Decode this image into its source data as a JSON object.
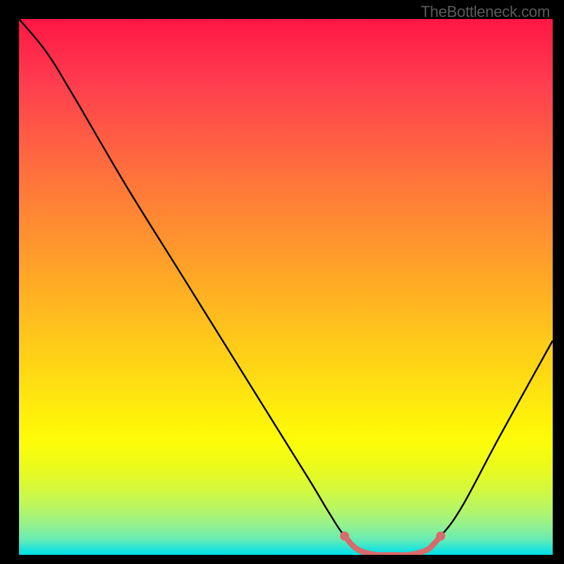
{
  "watermark": "TheBottleneck.com",
  "chart_data": {
    "type": "line",
    "title": "",
    "xlabel": "",
    "ylabel": "",
    "xlim": [
      0,
      100
    ],
    "ylim": [
      0,
      100
    ],
    "series": [
      {
        "name": "bottleneck-curve",
        "points": [
          {
            "x": 0,
            "y": 100
          },
          {
            "x": 5,
            "y": 94
          },
          {
            "x": 10,
            "y": 86
          },
          {
            "x": 20,
            "y": 69
          },
          {
            "x": 30,
            "y": 53
          },
          {
            "x": 40,
            "y": 37
          },
          {
            "x": 50,
            "y": 21
          },
          {
            "x": 55,
            "y": 13
          },
          {
            "x": 58,
            "y": 8
          },
          {
            "x": 61,
            "y": 3.5
          },
          {
            "x": 64,
            "y": 1
          },
          {
            "x": 67,
            "y": 0
          },
          {
            "x": 73,
            "y": 0
          },
          {
            "x": 76,
            "y": 1
          },
          {
            "x": 79,
            "y": 3.5
          },
          {
            "x": 83,
            "y": 9
          },
          {
            "x": 90,
            "y": 22
          },
          {
            "x": 100,
            "y": 40
          }
        ]
      },
      {
        "name": "optimal-highlight",
        "points": [
          {
            "x": 61,
            "y": 3.5
          },
          {
            "x": 63,
            "y": 1.3
          },
          {
            "x": 65,
            "y": 0.4
          },
          {
            "x": 67,
            "y": 0
          },
          {
            "x": 70,
            "y": 0
          },
          {
            "x": 73,
            "y": 0
          },
          {
            "x": 75,
            "y": 0.4
          },
          {
            "x": 77,
            "y": 1.3
          },
          {
            "x": 79,
            "y": 3.5
          }
        ]
      }
    ],
    "marker_points": [
      {
        "x": 61,
        "y": 3.5
      },
      {
        "x": 79,
        "y": 3.5
      }
    ]
  },
  "colors": {
    "curve": "#000000",
    "highlight": "#d86b6b",
    "marker": "#d86b6b"
  }
}
